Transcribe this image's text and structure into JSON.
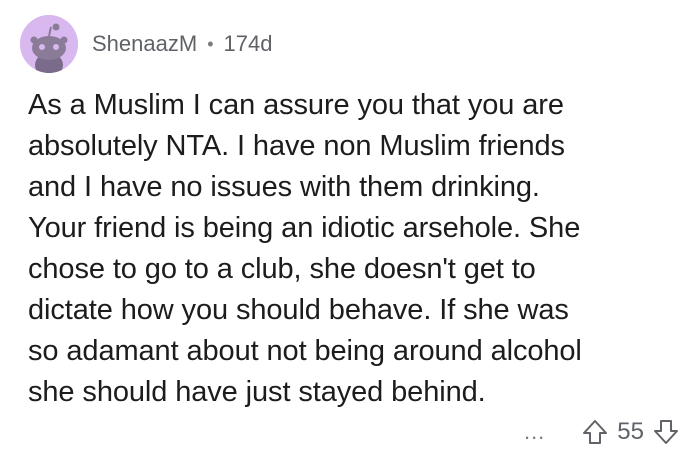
{
  "comment": {
    "username": "ShenaazM",
    "separator": "•",
    "age": "174d",
    "body_lines": [
      "As a Muslim I can assure you that you are",
      "absolutely NTA. I have non Muslim friends",
      "and I have no issues with them drinking.",
      "Your friend is being an idiotic arsehole. She",
      "chose to go to a club, she doesn't get to",
      "dictate how you should behave. If she was",
      "so adamant about not being around alcohol",
      "she should have just stayed behind."
    ],
    "more_label": "...",
    "score": "55",
    "avatar_color": "#d9b8f0",
    "upvote_icon": "up-arrow-icon",
    "downvote_icon": "down-arrow-icon"
  }
}
